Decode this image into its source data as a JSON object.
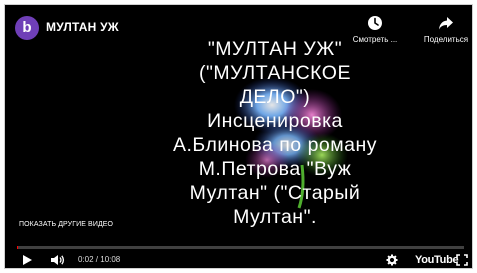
{
  "header": {
    "channel_initial": "b",
    "title": "МУЛТАН УЖ"
  },
  "actions": {
    "watch_later": {
      "label": "Смотреть ...",
      "icon": "clock-icon"
    },
    "share": {
      "label": "Поделиться",
      "icon": "share-arrow-icon"
    }
  },
  "overlay": {
    "lines": [
      "\"МУЛТАН УЖ\"",
      "(\"МУЛТАНСКОЕ",
      "ДЕЛО\")",
      "Инсценировка",
      "А.Блинова по роману",
      "М.Петрова \"Вуж",
      "Мултан\" (\"Старый",
      "Мултан\"."
    ]
  },
  "more_videos_label": "ПОКАЗАТЬ ДРУГИЕ ВИДЕО",
  "controls": {
    "time": "0:02 / 10:08",
    "progress_fraction": 0.0033,
    "youtube_label": "YouTube"
  },
  "colors": {
    "avatar": "#6f3fb7",
    "progress": "#ff0000",
    "background": "#000000"
  }
}
